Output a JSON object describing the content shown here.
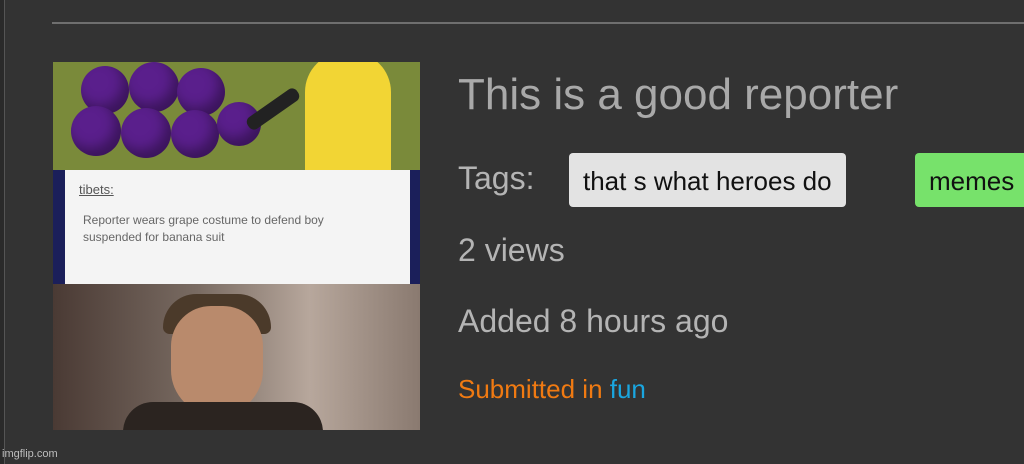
{
  "post": {
    "title": "This is a good reporter",
    "tags_label": "Tags:",
    "tags": [
      "that s what heroes do",
      "memes"
    ],
    "views": "2 views",
    "added": "Added 8 hours ago",
    "submitted_prefix": "Submitted in ",
    "category": "fun"
  },
  "thumbnail": {
    "tumblr_user": "tibets:",
    "tumblr_text": "Reporter wears grape costume to defend boy suspended for banana suit"
  },
  "watermark": "imgflip.com",
  "colors": {
    "background": "#333333",
    "tag_default": "#e3e3e3",
    "tag_highlight": "#77e26b",
    "submitted": "#f07a12",
    "category_link": "#1aa6e0"
  }
}
